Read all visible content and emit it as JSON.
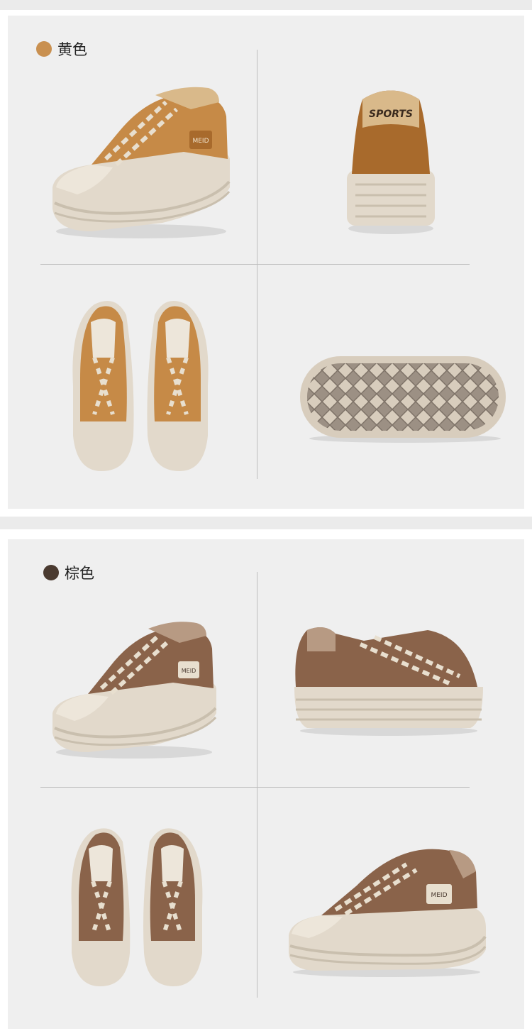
{
  "variants": [
    {
      "label": "黄色",
      "swatch": "#c99050",
      "upper": "#c68a47",
      "upper_dark": "#a86a2c",
      "trim": "#d9b98a"
    },
    {
      "label": "棕色",
      "swatch": "#4a3a30",
      "upper": "#8a634a",
      "upper_dark": "#6a4a36",
      "trim": "#b79a83"
    }
  ],
  "tags": {
    "patch": "MEID",
    "heel": "SPORTS"
  },
  "colors": {
    "sole": "#e2d9cb",
    "sole_shadow": "#c9bfae",
    "lace": "#e8dfcf",
    "panel_bg": "#efefef",
    "divider": "#bdbdbd"
  }
}
